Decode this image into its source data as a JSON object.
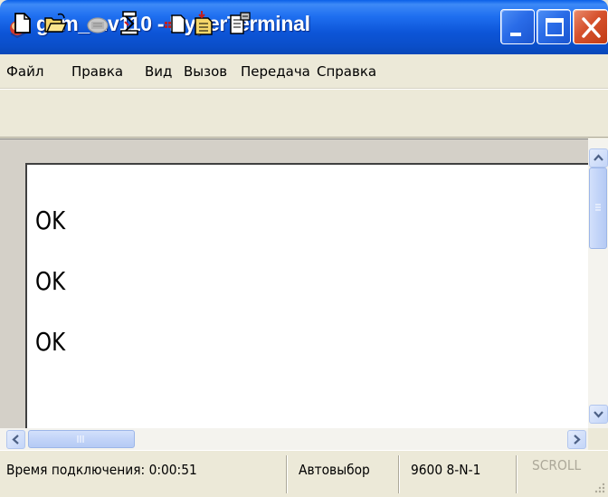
{
  "window": {
    "title": "gsm_mv110 - HyperTerminal",
    "icon": "hyperterminal-icon",
    "controls": [
      "minimize-icon",
      "maximize-icon",
      "close-icon"
    ]
  },
  "menu": {
    "items": [
      {
        "label": "Файл"
      },
      {
        "label": "Правка"
      },
      {
        "label": "Вид"
      },
      {
        "label": "Вызов"
      },
      {
        "label": "Передача"
      },
      {
        "label": "Справка"
      }
    ]
  },
  "toolbar": {
    "buttons": [
      {
        "icon": "new-document-icon"
      },
      {
        "icon": "open-folder-icon"
      },
      {
        "icon": "call-icon"
      },
      {
        "icon": "disconnect-icon"
      },
      {
        "icon": "send-file-icon"
      },
      {
        "icon": "receive-file-icon"
      },
      {
        "icon": "properties-icon"
      }
    ]
  },
  "terminal": {
    "lines": [
      "OK",
      "OK",
      "OK"
    ]
  },
  "status": {
    "connect_time": "Время подключения: 0:00:51",
    "detect": "Автовыбор",
    "port_settings": "9600 8-N-1",
    "scroll": "SCROLL"
  },
  "colors": {
    "titlebar": "#0a4ec9",
    "chrome": "#ece9d8",
    "terminal_bg": "#ffffff",
    "scroll_disabled_text": "#aca899"
  }
}
